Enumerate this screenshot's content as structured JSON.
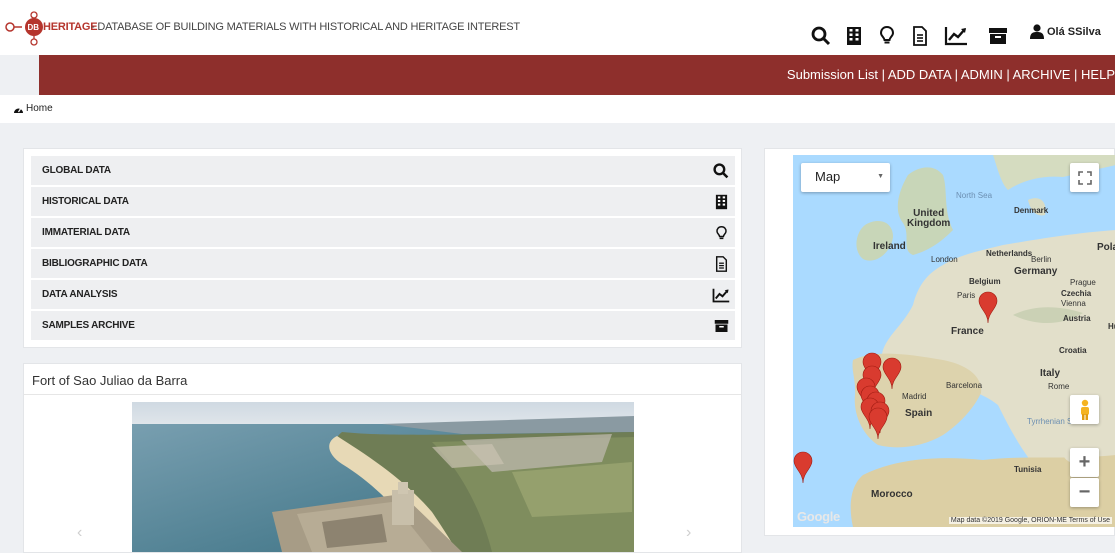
{
  "header": {
    "logo_text": "HERITAGE",
    "logo_badge": "DB",
    "description": "- DATABASE OF BUILDING MATERIALS WITH HISTORICAL AND HERITAGE INTEREST",
    "icons": [
      "search-icon",
      "building-icon",
      "lightbulb-icon",
      "document-icon",
      "chart-icon",
      "archive-icon"
    ],
    "user_greeting": "Olá SSilva"
  },
  "nav": {
    "links": [
      "Submission List",
      "ADD DATA",
      "ADMIN",
      "ARCHIVE",
      "HELP"
    ],
    "separator": " | "
  },
  "breadcrumb": {
    "home_label": "Home"
  },
  "data_sections": [
    {
      "label": "GLOBAL DATA",
      "icon": "search-icon"
    },
    {
      "label": "HISTORICAL DATA",
      "icon": "building-icon"
    },
    {
      "label": "IMMATERIAL DATA",
      "icon": "lightbulb-icon"
    },
    {
      "label": "BIBLIOGRAPHIC DATA",
      "icon": "document-icon"
    },
    {
      "label": "DATA ANALYSIS",
      "icon": "chart-icon"
    },
    {
      "label": "SAMPLES ARCHIVE",
      "icon": "archive-icon"
    }
  ],
  "featured": {
    "title": "Fort of Sao Juliao da Barra",
    "prev_arrow": "‹",
    "next_arrow": "›"
  },
  "map": {
    "type_selected": "Map",
    "labels": {
      "north_sea": "North Sea",
      "united_kingdom": "United Kingdom",
      "denmark": "Denmark",
      "ireland": "Ireland",
      "london": "London",
      "netherlands": "Netherlands",
      "berlin": "Berlin",
      "germany": "Germany",
      "pol": "Pola",
      "belgium": "Belgium",
      "prague": "Prague",
      "czechia": "Czechia",
      "vienna": "Vienna",
      "paris": "Paris",
      "france": "France",
      "austria": "Austria",
      "hu": "Hu",
      "croatia": "Croatia",
      "italy": "Italy",
      "rome": "Rome",
      "barcelona": "Barcelona",
      "madrid": "Madrid",
      "spain": "Spain",
      "tyrrhenian": "Tyrrhenian Sea",
      "tunisia": "Tunisia",
      "morocco": "Morocco"
    },
    "google_logo": "Google",
    "attribution": "Map data ©2019 Google, ORION-ME   Terms of Use",
    "zoom_in": "+",
    "zoom_out": "−",
    "colors": {
      "water": "#aadaff",
      "land": "#e8e6d6",
      "marker": "#d93b2f",
      "nav": "#8e2f2c"
    }
  }
}
